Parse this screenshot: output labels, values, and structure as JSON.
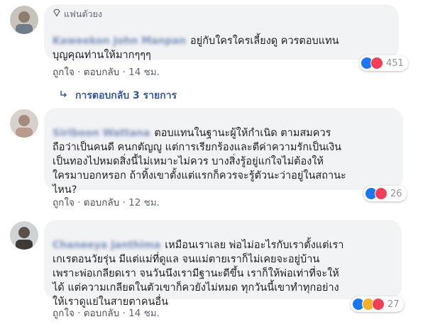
{
  "comments": [
    {
      "badge": "แฟนตัวยง",
      "author": "Kaweekon John Manpan",
      "text": "อยู่กับใครใครเลี้ยงดู ควรตอบแทน\nบุญคุณท่านให้มากๆๆๆ",
      "actions": {
        "like": "ถูกใจ",
        "reply": "ตอบกลับ",
        "time": "14 ชม."
      },
      "reaction_count": "451",
      "reactions": [
        "like-icon",
        "love-icon"
      ]
    },
    {
      "author": "Siriboon Wattana",
      "text": "ตอบแทนในฐานะผู้ให้กำเนิด ตามสมควร\nถือว่าเป็นคนดี คนกตัญญู แต่การเรียกร้องและตีค่าความรักเป็นเงิน\nเป็นทองไปหมดสิ่งนี้ไม่เหมาะไม่ควร บางสิ่งรู้อยู่แก่ใจไม่ต้องให้\nใครมาบอกหรอก ถ้าทิ้งเขาตั้งแต่แรกก็ควรจะรู้ตัวนะว่าอยู่ในสถานะ\nไหน?",
      "actions": {
        "like": "ถูกใจ",
        "reply": "ตอบกลับ",
        "time": "12 ชม."
      },
      "reaction_count": "26",
      "reactions": [
        "like-icon",
        "love-icon"
      ]
    },
    {
      "author": "Chaneeya Janthima",
      "text": "เหมือนเราเลย พ่อไม่อะไรกับเราตั้งแต่เรา\nเกเรตอนวัยรุ่น มีแต่แม่ที่ดูแล จนแม่ตายเราก็ไม่เคยจะอยู่บ้าน\nเพราะพ่อเกลียดเรา จนวันนึงเรามีฐานะดีขึ้น เราก็ให้พ่อเท่าที่จะให้\nได้ แต่ความเกลียดในตัวเขาก็ควยังไม่หมด ทุกวันนี้เขาทำทุกอย่าง\nให้เราดูแย่ในสายตาคนอื่น",
      "actions": {
        "like": "ถูกใจ",
        "reply": "ตอบกลับ",
        "time": "14 ชม."
      },
      "reaction_count": "27",
      "reactions": [
        "like-icon",
        "sad-icon",
        "love-icon"
      ]
    }
  ],
  "replies_link": "การตอบกลับ 3 รายการ",
  "separator": "·",
  "colors": {
    "link": "#385898",
    "bubble": "#f2f3f5",
    "like": "#1877f2",
    "love": "#f33e58",
    "sad": "#f7b125"
  }
}
